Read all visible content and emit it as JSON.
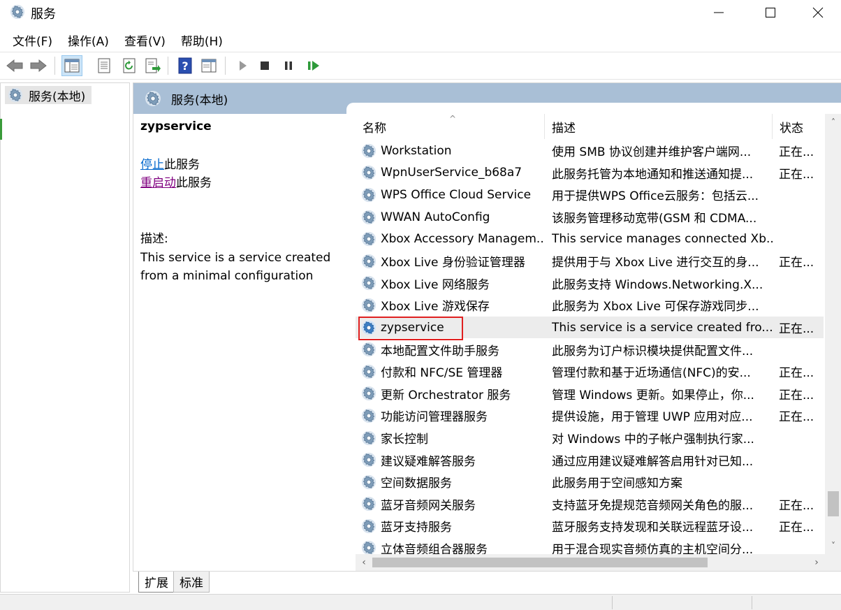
{
  "window": {
    "title": "服务",
    "icon": "services-gear-icon"
  },
  "menubar": {
    "items": [
      "文件(F)",
      "操作(A)",
      "查看(V)",
      "帮助(H)"
    ]
  },
  "toolbar": {
    "buttons": [
      "back-arrow-icon",
      "forward-arrow-icon",
      "show-hide-console-tree-icon",
      "properties-icon",
      "refresh-icon",
      "export-list-icon",
      "help-icon",
      "action-pane-icon",
      "start-service-icon",
      "stop-service-icon",
      "pause-service-icon",
      "resume-service-icon"
    ]
  },
  "tree": {
    "root_label": "服务(本地)"
  },
  "panel": {
    "header_title": "服务(本地)",
    "selected_service": {
      "name": "zypservice",
      "stop_link": "停止",
      "stop_suffix": "此服务",
      "restart_link": "重启动",
      "restart_suffix": "此服务",
      "desc_label": "描述:",
      "desc_line1": "This service is a service created",
      "desc_line2": "from a minimal configuration"
    }
  },
  "list": {
    "columns": {
      "name": "名称",
      "desc": "描述",
      "status": "状态"
    },
    "rows": [
      {
        "name": "Workstation",
        "desc": "使用 SMB 协议创建并维护客户端网...",
        "status": "正在..."
      },
      {
        "name": "WpnUserService_b68a7",
        "desc": "此服务托管为本地通知和推送通知提...",
        "status": "正在..."
      },
      {
        "name": "WPS Office Cloud Service",
        "desc": "用于提供WPS Office云服务：包括云...",
        "status": ""
      },
      {
        "name": "WWAN AutoConfig",
        "desc": "该服务管理移动宽带(GSM 和 CDMA...",
        "status": ""
      },
      {
        "name": "Xbox Accessory Managem...",
        "desc": "This service manages connected Xb...",
        "status": ""
      },
      {
        "name": "Xbox Live 身份验证管理器",
        "desc": "提供用于与 Xbox Live 进行交互的身...",
        "status": "正在..."
      },
      {
        "name": "Xbox Live 网络服务",
        "desc": "此服务支持 Windows.Networking.X...",
        "status": ""
      },
      {
        "name": "Xbox Live 游戏保存",
        "desc": "此服务为 Xbox Live 可保存游戏同步...",
        "status": ""
      },
      {
        "name": "zypservice",
        "desc": "This service is a service created fro...",
        "status": "正在...",
        "selected": true
      },
      {
        "name": "本地配置文件助手服务",
        "desc": "此服务为订户标识模块提供配置文件...",
        "status": ""
      },
      {
        "name": "付款和 NFC/SE 管理器",
        "desc": "管理付款和基于近场通信(NFC)的安...",
        "status": "正在..."
      },
      {
        "name": "更新 Orchestrator 服务",
        "desc": "管理 Windows 更新。如果停止，你...",
        "status": "正在..."
      },
      {
        "name": "功能访问管理器服务",
        "desc": "提供设施，用于管理 UWP 应用对应...",
        "status": "正在..."
      },
      {
        "name": "家长控制",
        "desc": "对 Windows 中的子帐户强制执行家...",
        "status": ""
      },
      {
        "name": "建议疑难解答服务",
        "desc": "通过应用建议疑难解答启用针对已知...",
        "status": ""
      },
      {
        "name": "空间数据服务",
        "desc": "此服务用于空间感知方案",
        "status": ""
      },
      {
        "name": "蓝牙音频网关服务",
        "desc": "支持蓝牙免提规范音频网关角色的服...",
        "status": "正在..."
      },
      {
        "name": "蓝牙支持服务",
        "desc": "蓝牙服务支持发现和关联远程蓝牙设...",
        "status": "正在..."
      },
      {
        "name": "立体音频组合器服务",
        "desc": "用于混合现实音频仿真的主机空间分...",
        "status": ""
      }
    ]
  },
  "tabs": {
    "extended": "扩展",
    "standard": "标准"
  },
  "colors": {
    "panel_header": "#a9bfd6",
    "selection_outline": "#e02020",
    "stop_link": "#0066cc",
    "restart_link": "#800080"
  }
}
